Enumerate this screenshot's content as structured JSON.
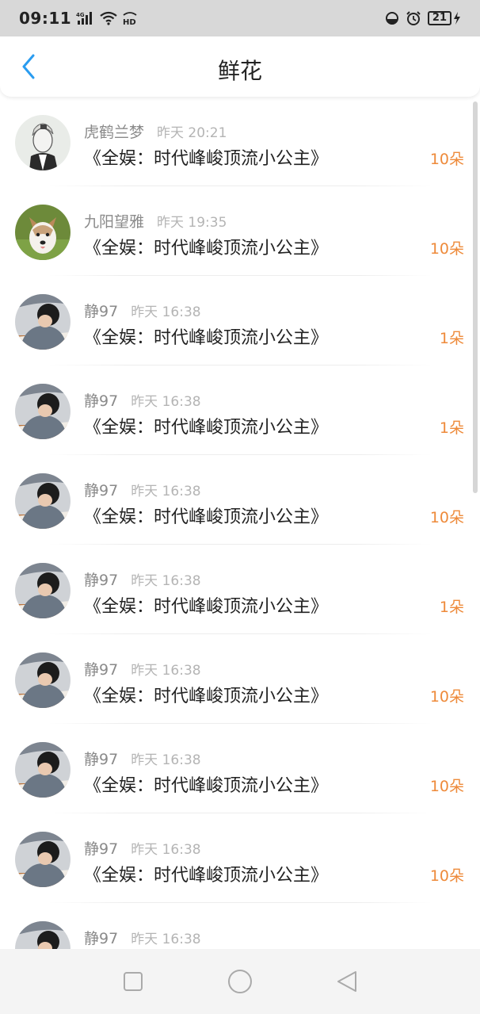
{
  "status_bar": {
    "time": "09:11",
    "network": "4G",
    "hd": "HD",
    "battery": "21"
  },
  "header": {
    "title": "鲜花"
  },
  "items": [
    {
      "user": "虎鹤兰梦",
      "time": "昨天 20:21",
      "book": "《全娱：时代峰峻顶流小公主》",
      "count": "10朵",
      "avatar": "sketch"
    },
    {
      "user": "九阳望雅",
      "time": "昨天 19:35",
      "book": "《全娱：时代峰峻顶流小公主》",
      "count": "10朵",
      "avatar": "dog"
    },
    {
      "user": "静97",
      "time": "昨天 16:38",
      "book": "《全娱：时代峰峻顶流小公主》",
      "count": "1朵",
      "avatar": "student"
    },
    {
      "user": "静97",
      "time": "昨天 16:38",
      "book": "《全娱：时代峰峻顶流小公主》",
      "count": "1朵",
      "avatar": "student"
    },
    {
      "user": "静97",
      "time": "昨天 16:38",
      "book": "《全娱：时代峰峻顶流小公主》",
      "count": "10朵",
      "avatar": "student"
    },
    {
      "user": "静97",
      "time": "昨天 16:38",
      "book": "《全娱：时代峰峻顶流小公主》",
      "count": "1朵",
      "avatar": "student"
    },
    {
      "user": "静97",
      "time": "昨天 16:38",
      "book": "《全娱：时代峰峻顶流小公主》",
      "count": "10朵",
      "avatar": "student"
    },
    {
      "user": "静97",
      "time": "昨天 16:38",
      "book": "《全娱：时代峰峻顶流小公主》",
      "count": "10朵",
      "avatar": "student"
    },
    {
      "user": "静97",
      "time": "昨天 16:38",
      "book": "《全娱：时代峰峻顶流小公主》",
      "count": "10朵",
      "avatar": "student"
    },
    {
      "user": "静97",
      "time": "昨天 16:38",
      "book": "",
      "count": "",
      "avatar": "student"
    }
  ],
  "nav_bar": {
    "icons": [
      "square-icon",
      "circle-icon",
      "back-triangle-icon"
    ]
  },
  "colors": {
    "accent": "#2a9cf0",
    "count": "#ee8a3a",
    "status_bar": "#d8d8d8"
  }
}
